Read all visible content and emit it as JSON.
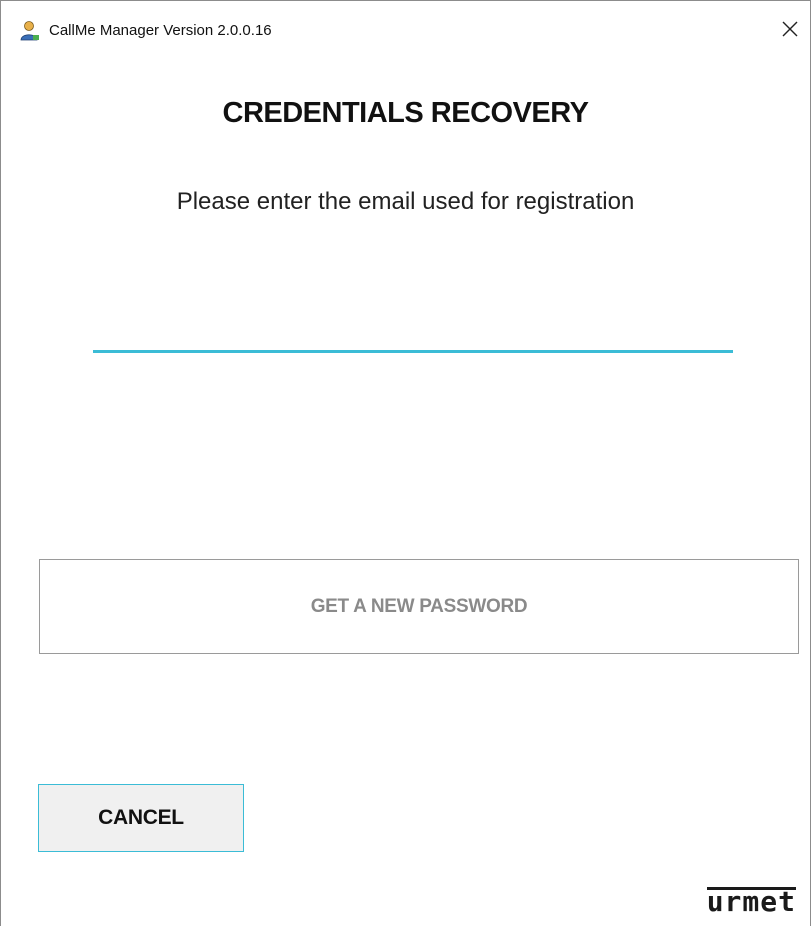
{
  "window": {
    "title": "CallMe Manager Version 2.0.0.16",
    "app_icon": "user-avatar-icon",
    "close_icon": "close-icon",
    "close_glyph": "✕"
  },
  "main": {
    "heading": "CREDENTIALS RECOVERY",
    "instruction": "Please enter the email used for registration",
    "email_input": {
      "value": "",
      "placeholder": ""
    },
    "get_password_label": "GET A NEW PASSWORD",
    "cancel_label": "CANCEL"
  },
  "brand": {
    "logo_text": "urmet"
  },
  "colors": {
    "accent": "#3bbcd6",
    "disabled_text": "#8a8a8a",
    "text": "#111111"
  }
}
